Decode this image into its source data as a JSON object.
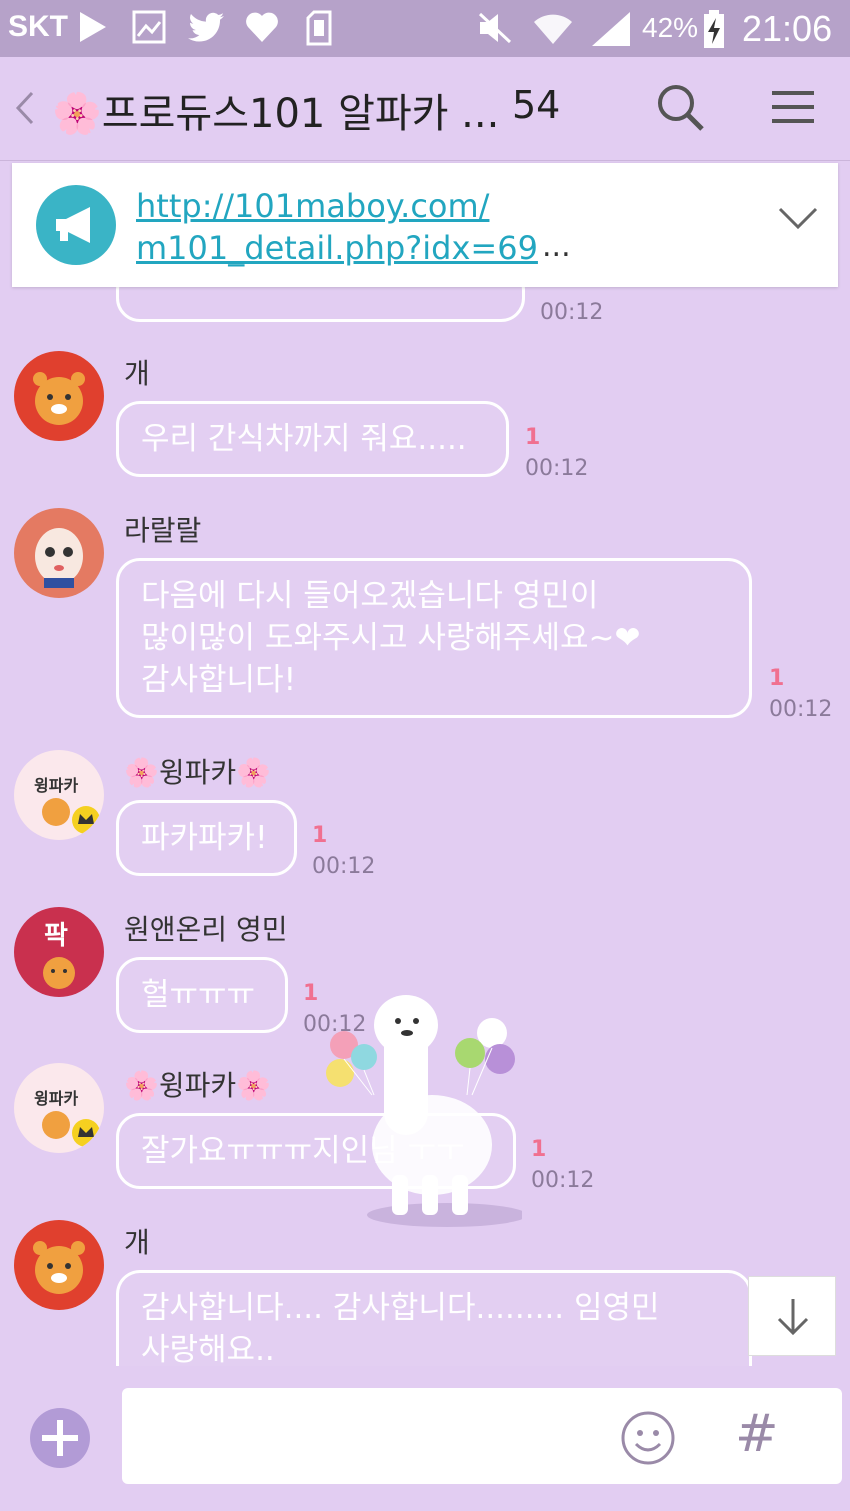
{
  "status_bar": {
    "carrier": "SKT",
    "battery_percent": "42%",
    "time": "21:06",
    "icons": [
      "play-icon",
      "image-icon",
      "twitter-icon",
      "heart-icon",
      "sd-card-icon",
      "mute-icon",
      "wifi-icon",
      "signal-icon",
      "battery-charging-icon"
    ]
  },
  "header": {
    "room_title": "🌸프로듀스101 알파카 ...",
    "member_count": "54",
    "icons": [
      "back-icon",
      "search-icon",
      "menu-icon"
    ]
  },
  "notice": {
    "link_line1": "http://101maboy.com/",
    "link_line2": "m101_detail.php?idx=69",
    "ellipsis": "...",
    "icons": [
      "megaphone-icon",
      "chevron-down-icon"
    ]
  },
  "partial_message": {
    "time": "00:12"
  },
  "messages": [
    {
      "sender": "개",
      "text": "우리 간식차까지 줘요.....",
      "unread": "1",
      "time": "00:12"
    },
    {
      "sender": "라랄랄",
      "lines": [
        "다음에 다시 들어오겠습니다 영민이",
        "많이많이 도와주시고 사랑해주세요~❤",
        "감사합니다!"
      ],
      "unread": "1",
      "time": "00:12"
    },
    {
      "sender": "🌸윙파카🌸",
      "text": "파카파카!",
      "unread": "1",
      "time": "00:12"
    },
    {
      "sender": "원앤온리 영민",
      "text": "헐ㅠㅠㅠ",
      "unread": "1",
      "time": "00:12"
    },
    {
      "sender": "🌸윙파카🌸",
      "text": "잘가요ㅠㅠㅠ지인님 ㅜㅜ",
      "unread": "1",
      "time": "00:12"
    },
    {
      "sender": "개",
      "lines": [
        "감사합니다.... 감사합니다......... 임영민",
        "사랑해요.."
      ]
    }
  ],
  "avatars": {
    "wingpaka_label": "윙파카",
    "pak_label": "팍"
  },
  "input_bar": {
    "hash_label": "#",
    "icons": [
      "plus-icon",
      "emoji-icon",
      "scroll-down-icon"
    ]
  },
  "colors": {
    "background": "#e2cdf2",
    "status_bar": "#b6a2c9",
    "link": "#22a6c0",
    "unread": "#f07090",
    "time": "#8b7a9a",
    "megaphone": "#3ab4c6"
  }
}
